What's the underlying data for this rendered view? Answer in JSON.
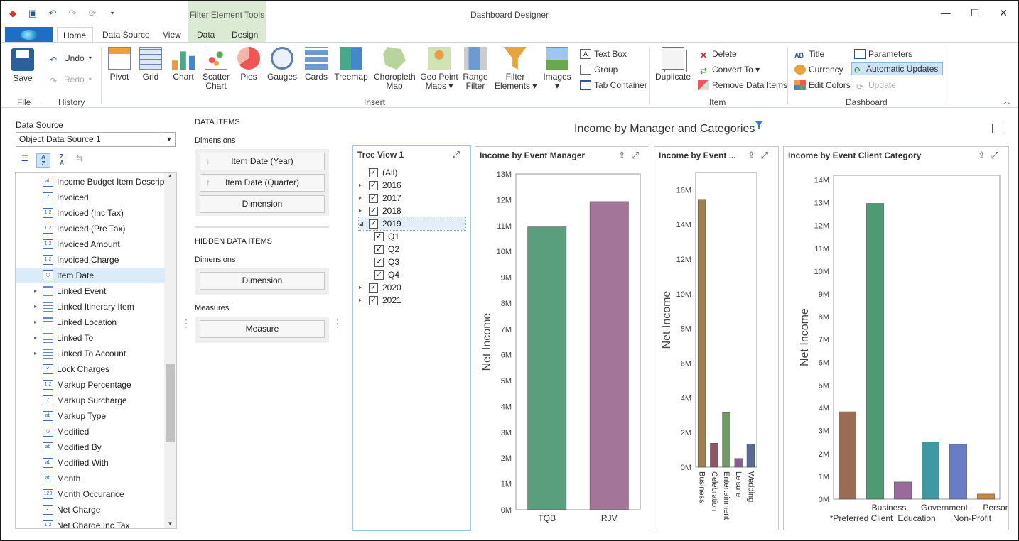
{
  "window": {
    "title": "Dashboard Designer",
    "context_group": "Filter Element Tools",
    "controls": [
      "—",
      "☐",
      "✕"
    ]
  },
  "tabs": [
    "Home",
    "Data Source",
    "View",
    "Data",
    "Design"
  ],
  "ribbon": {
    "save": "Save",
    "undo": "Undo",
    "redo": "Redo",
    "groups": {
      "file": "File",
      "history": "History",
      "insert": "Insert",
      "item": "Item",
      "dashboard": "Dashboard"
    },
    "insert": [
      "Pivot",
      "Grid",
      "Chart",
      "Scatter\nChart",
      "Pies",
      "Gauges",
      "Cards",
      "Treemap",
      "Choropleth\nMap",
      "Geo Point\nMaps ▾",
      "Range\nFilter",
      "Filter\nElements ▾",
      "Images\n▾"
    ],
    "text_box": "Text Box",
    "group": "Group",
    "tab_container": "Tab Container",
    "duplicate": "Duplicate",
    "delete": "Delete",
    "convert_to": "Convert To ▾",
    "remove_data_items": "Remove Data Items",
    "title": "Title",
    "currency": "Currency",
    "edit_colors": "Edit Colors",
    "parameters": "Parameters",
    "automatic_updates": "Automatic Updates",
    "update": "Update"
  },
  "data_source": {
    "label": "Data Source",
    "value": "Object Data Source 1"
  },
  "fields": [
    {
      "name": "Income Budget Item Descript...",
      "icon": "ab",
      "expand": false
    },
    {
      "name": "Invoiced",
      "icon": "✓",
      "expand": false
    },
    {
      "name": "Invoiced (Inc Tax)",
      "icon": "1.2",
      "expand": false
    },
    {
      "name": "Invoiced (Pre Tax)",
      "icon": "1.2",
      "expand": false
    },
    {
      "name": "Invoiced Amount",
      "icon": "1.2",
      "expand": false
    },
    {
      "name": "Invoiced Charge",
      "icon": "1.2",
      "expand": false
    },
    {
      "name": "Item Date",
      "icon": "◷",
      "expand": false,
      "selected": true
    },
    {
      "name": "Linked Event",
      "icon": "tbl",
      "expand": true
    },
    {
      "name": "Linked Itinerary Item",
      "icon": "tbl",
      "expand": true
    },
    {
      "name": "Linked Location",
      "icon": "tbl",
      "expand": true
    },
    {
      "name": "Linked To",
      "icon": "tbl",
      "expand": true
    },
    {
      "name": "Linked To Account",
      "icon": "tbl",
      "expand": true
    },
    {
      "name": "Lock Charges",
      "icon": "✓",
      "expand": false
    },
    {
      "name": "Markup Percentage",
      "icon": "1.2",
      "expand": false
    },
    {
      "name": "Markup Surcharge",
      "icon": "✓",
      "expand": false
    },
    {
      "name": "Markup Type",
      "icon": "ab",
      "expand": false
    },
    {
      "name": "Modified",
      "icon": "◷",
      "expand": false
    },
    {
      "name": "Modified By",
      "icon": "ab",
      "expand": false
    },
    {
      "name": "Modified With",
      "icon": "ab",
      "expand": false
    },
    {
      "name": "Month",
      "icon": "ab",
      "expand": false
    },
    {
      "name": "Month Occurance",
      "icon": "123",
      "expand": false
    },
    {
      "name": "Net Charge",
      "icon": "✓",
      "expand": false
    },
    {
      "name": "Net Charge Inc Tax",
      "icon": "1.2",
      "expand": false
    }
  ],
  "data_items": {
    "header": "DATA ITEMS",
    "dimensions_label": "Dimensions",
    "dimensions": [
      "Item Date (Year)",
      "Item Date (Quarter)",
      "Dimension"
    ],
    "hidden_header": "HIDDEN DATA ITEMS",
    "hidden_dimensions_label": "Dimensions",
    "hidden_dimension": "Dimension",
    "measures_label": "Measures",
    "measure": "Measure"
  },
  "dashboard_title": "Income by Manager and Categories",
  "tree": {
    "title": "Tree View 1",
    "nodes": [
      {
        "label": "(All)",
        "level": 0,
        "arrow": ""
      },
      {
        "label": "2016",
        "level": 0,
        "arrow": "▸"
      },
      {
        "label": "2017",
        "level": 0,
        "arrow": "▸"
      },
      {
        "label": "2018",
        "level": 0,
        "arrow": "▸"
      },
      {
        "label": "2019",
        "level": 0,
        "arrow": "◢",
        "selected": true
      },
      {
        "label": "Q1",
        "level": 1,
        "arrow": ""
      },
      {
        "label": "Q2",
        "level": 1,
        "arrow": ""
      },
      {
        "label": "Q3",
        "level": 1,
        "arrow": ""
      },
      {
        "label": "Q4",
        "level": 1,
        "arrow": ""
      },
      {
        "label": "2020",
        "level": 0,
        "arrow": "▸"
      },
      {
        "label": "2021",
        "level": 0,
        "arrow": "▸"
      }
    ]
  },
  "chart_data": [
    {
      "type": "bar",
      "title": "Income by Event Manager",
      "ylabel": "Net Income",
      "ylim": [
        0,
        13
      ],
      "ytick_step": 1,
      "categories": [
        "TQB",
        "RJV"
      ],
      "values": [
        10.95,
        11.93
      ],
      "colors": [
        "#5b9e7e",
        "#a37699"
      ]
    },
    {
      "type": "bar",
      "title": "Income by Event ...",
      "ylabel": "Net Income",
      "ylim": [
        0,
        17
      ],
      "ytick_step": 2,
      "categories": [
        "Business",
        "Celebration",
        "Entertainment",
        "Leisure",
        "Wedding"
      ],
      "values": [
        15.45,
        1.38,
        3.15,
        0.5,
        1.32
      ],
      "colors": [
        "#a0804e",
        "#8e5566",
        "#6e9a63",
        "#8a5b8f",
        "#5a6a98"
      ],
      "rotate_labels": true
    },
    {
      "type": "bar",
      "title": "Income by Event Client Category",
      "ylabel": "Net Income",
      "ylim": [
        0,
        14.2
      ],
      "ytick_step": 1,
      "categories": [
        "*Preferred Client",
        "Business",
        "Education",
        "Government",
        "Non-Profit",
        "Personal"
      ],
      "values": [
        3.83,
        12.97,
        0.75,
        2.5,
        2.4,
        0.22
      ],
      "colors": [
        "#9a6b55",
        "#4e9a72",
        "#9a6a9a",
        "#3d9aa0",
        "#6a7cc8",
        "#c88a3a"
      ]
    }
  ]
}
